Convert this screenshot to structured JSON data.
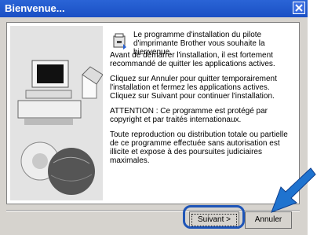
{
  "window": {
    "title": "Bienvenue..."
  },
  "header_text": "Le programme d'installation du pilote d'imprimante Brother vous souhaite la bienvenue.",
  "paragraphs": [
    "Avant de démarrer l'installation, il est fortement recommandé de quitter les applications actives.",
    "Cliquez sur Annuler pour quitter temporairement l'installation et fermez les applications actives. Cliquez sur Suivant pour continuer l'installation.",
    "ATTENTION : Ce programme est protégé par copyright et par traités internationaux.",
    "Toute reproduction ou distribution totale ou partielle de ce programme effectuée sans autorisation est illicite et expose à des poursuites judiciaires maximales."
  ],
  "buttons": {
    "next": "Suivant >",
    "cancel": "Annuler"
  },
  "colors": {
    "accent": "#1f55b7",
    "titlebar": "#1a4fc4"
  },
  "icons": {
    "close": "close-icon",
    "installer": "installer-icon",
    "computer": "computer-illustration",
    "globe": "globe-illustration",
    "arrow": "arrow-pointer-icon"
  }
}
